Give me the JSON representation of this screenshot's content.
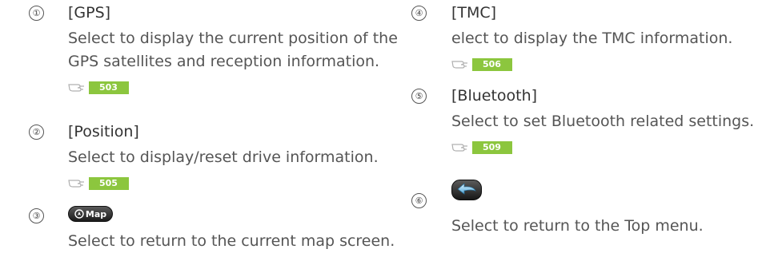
{
  "colors": {
    "badge_bg": "#8cc63e",
    "text": "#555555",
    "button_dark": "#1b1b1b"
  },
  "items": [
    {
      "number": "①",
      "title": "[GPS]",
      "description": [
        "Select to display the current position of the",
        "GPS satellites and reception information."
      ],
      "ref_page": "503",
      "ref_icon": "pointing-hand-icon"
    },
    {
      "number": "②",
      "title": "[Position]",
      "description": [
        "Select to display/reset drive information."
      ],
      "ref_page": "505",
      "ref_icon": "pointing-hand-icon"
    },
    {
      "number": "③",
      "button_label": "Map",
      "button_icon": "map-button-icon",
      "description": [
        "Select to return to the current map screen."
      ]
    },
    {
      "number": "④",
      "title": "[TMC]",
      "description": [
        "elect to display the TMC information."
      ],
      "ref_page": "506",
      "ref_icon": "pointing-hand-icon"
    },
    {
      "number": "⑤",
      "title": "[Bluetooth]",
      "description": [
        "Select to set Bluetooth related settings."
      ],
      "ref_page": "509",
      "ref_icon": "pointing-hand-icon"
    },
    {
      "number": "⑥",
      "button_icon": "return-arrow-icon",
      "description": [
        "Select to return to the Top menu."
      ]
    }
  ]
}
